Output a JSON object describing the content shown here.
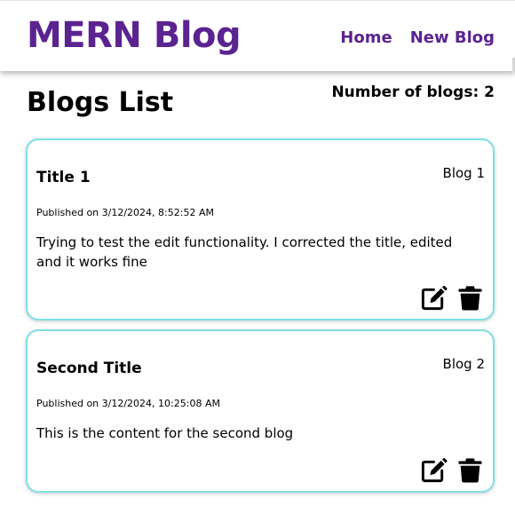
{
  "header": {
    "brand": "MERN Blog",
    "nav": [
      {
        "label": "Home"
      },
      {
        "label": "New Blog"
      }
    ]
  },
  "main": {
    "title": "Blogs List",
    "count_label": "Number of blogs: 2"
  },
  "blogs": [
    {
      "title": "Title 1",
      "number": "Blog 1",
      "published": "Published on 3/12/2024, 8:52:52 AM",
      "content": "Trying to test the edit functionality. I corrected the title, edited and it works fine",
      "actions": {
        "edit_icon": "edit-icon",
        "delete_icon": "trash-icon"
      }
    },
    {
      "title": "Second Title",
      "number": "Blog 2",
      "published": "Published on 3/12/2024, 10:25:08 AM",
      "content": "This is the content for the second blog",
      "actions": {
        "edit_icon": "edit-icon",
        "delete_icon": "trash-icon"
      }
    }
  ],
  "colors": {
    "brand": "#5b2390",
    "card_border": "#7fe0e6"
  }
}
